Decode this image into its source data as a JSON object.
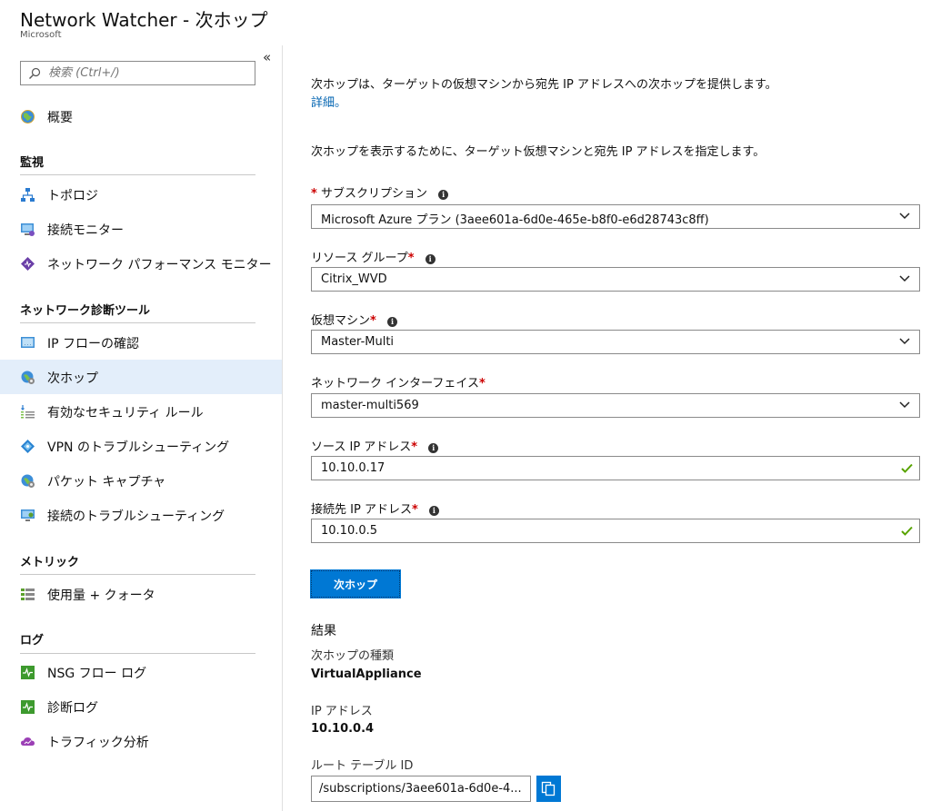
{
  "header": {
    "title": "Network Watcher - 次ホップ",
    "subtitle": "Microsoft"
  },
  "sidebar": {
    "collapse_glyph": "«",
    "search_placeholder": "検索 (Ctrl+/)",
    "overview": {
      "label": "概要",
      "icon": "globe-icon"
    },
    "sections": {
      "monitoring": "監視",
      "diag_tools": "ネットワーク診断ツール",
      "metrics": "メトリック",
      "logs": "ログ"
    },
    "items": {
      "topology": "トポロジ",
      "connection_monitor": "接続モニター",
      "npm": "ネットワーク パフォーマンス モニター",
      "ip_flow": "IP フローの確認",
      "next_hop": "次ホップ",
      "security_rules": "有効なセキュリティ ルール",
      "vpn_troubleshoot": "VPN のトラブルシューティング",
      "packet_capture": "パケット キャプチャ",
      "connection_troubleshoot": "接続のトラブルシューティング",
      "usage_quota": "使用量 + クォータ",
      "nsg_flow_logs": "NSG フロー ログ",
      "diag_logs": "診断ログ",
      "traffic_analytics": "トラフィック分析"
    },
    "active_item": "next_hop"
  },
  "main": {
    "description": "次ホップは、ターゲットの仮想マシンから宛先 IP アドレスへの次ホップを提供します。",
    "learn_more": "詳細。",
    "instruction": "次ホップを表示するために、ターゲット仮想マシンと宛先 IP アドレスを指定します。",
    "required_mark": "*",
    "fields": {
      "subscription": {
        "label": "サブスクリプション",
        "value": "Microsoft Azure プラン (3aee601a-6d0e-465e-b8f0-e6d28743c8ff)"
      },
      "resource_group": {
        "label": "リソース グループ",
        "value": "Citrix_WVD"
      },
      "vm": {
        "label": "仮想マシン",
        "value": "Master-Multi"
      },
      "nic": {
        "label": "ネットワーク インターフェイス",
        "value": "master-multi569"
      },
      "source_ip": {
        "label": "ソース IP アドレス",
        "value": "10.10.0.17"
      },
      "dest_ip": {
        "label": "接続先 IP アドレス",
        "value": "10.10.0.5"
      }
    },
    "submit_label": "次ホップ",
    "results": {
      "title": "結果",
      "next_hop_type_label": "次ホップの種類",
      "next_hop_type_value": "VirtualAppliance",
      "ip_label": "IP アドレス",
      "ip_value": "10.10.0.4",
      "route_table_label": "ルート テーブル ID",
      "route_table_value": "/subscriptions/3aee601a-6d0e-4..."
    }
  },
  "colors": {
    "accent": "#0078d4",
    "active_bg": "#e3eefa",
    "valid_check": "#57a300",
    "required": "#cc0000"
  }
}
